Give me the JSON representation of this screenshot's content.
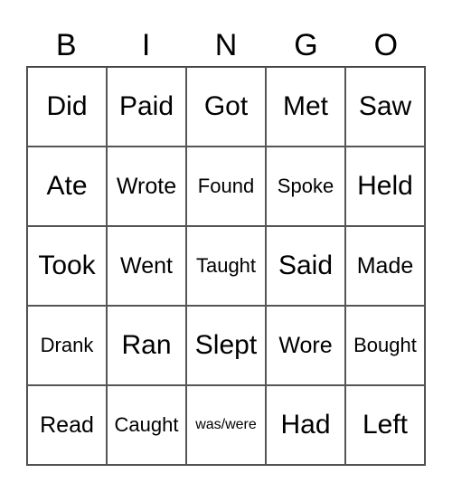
{
  "header": [
    "B",
    "I",
    "N",
    "G",
    "O"
  ],
  "cells": [
    "Did",
    "Paid",
    "Got",
    "Met",
    "Saw",
    "Ate",
    "Wrote",
    "Found",
    "Spoke",
    "Held",
    "Took",
    "Went",
    "Taught",
    "Said",
    "Made",
    "Drank",
    "Ran",
    "Slept",
    "Wore",
    "Bought",
    "Read",
    "Caught",
    "was/were",
    "Had",
    "Left"
  ]
}
